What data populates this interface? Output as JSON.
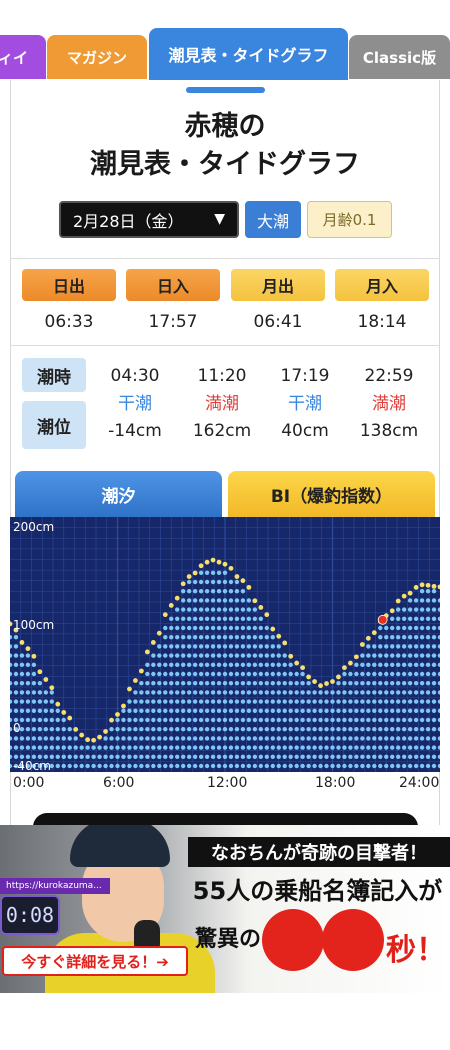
{
  "tabs": [
    {
      "label": "ィイ",
      "active": false
    },
    {
      "label": "マガジン",
      "active": false
    },
    {
      "label": "潮見表・タイドグラフ",
      "active": true
    },
    {
      "label": "Classic版",
      "active": false
    }
  ],
  "page": {
    "title_line1": "赤穂の",
    "title_line2": "潮見表・タイドグラフ",
    "date": "2月28日（金）",
    "tide_type": "大潮",
    "moon_age": "月齢0.1"
  },
  "sun_moon": [
    {
      "label": "日出",
      "time": "06:33",
      "kind": "sun"
    },
    {
      "label": "日入",
      "time": "17:57",
      "kind": "sun"
    },
    {
      "label": "月出",
      "time": "06:41",
      "kind": "moon"
    },
    {
      "label": "月入",
      "time": "18:14",
      "kind": "moon"
    }
  ],
  "tides": {
    "time_label": "潮時",
    "level_label": "潮位",
    "entries": [
      {
        "time": "04:30",
        "kind": "干潮",
        "type": "low",
        "level": "-14cm"
      },
      {
        "time": "11:20",
        "kind": "満潮",
        "type": "high",
        "level": "162cm"
      },
      {
        "time": "17:19",
        "kind": "干潮",
        "type": "low",
        "level": "40cm"
      },
      {
        "time": "22:59",
        "kind": "満潮",
        "type": "high",
        "level": "138cm"
      }
    ]
  },
  "chart_tabs": {
    "active": "潮汐",
    "inactive": "BI（爆釣指数）"
  },
  "chart_data": {
    "type": "area",
    "title": "",
    "xlabel": "",
    "ylabel": "",
    "y_tick_labels": [
      "200cm",
      "100cm",
      "0",
      "-40cm"
    ],
    "x_tick_labels": [
      "0:00",
      "6:00",
      "12:00",
      "18:00",
      "24:00"
    ],
    "ylim": [
      -40,
      200
    ],
    "xlim": [
      0,
      24
    ],
    "grid": true,
    "series": [
      {
        "x": [
          0,
          1,
          2,
          3,
          4,
          4.5,
          5,
          6,
          7,
          8,
          9,
          10,
          11,
          11.33,
          12,
          13,
          14,
          15,
          16,
          17,
          17.32,
          18,
          19,
          20,
          21,
          22,
          22.98,
          24
        ],
        "values": [
          100,
          76,
          46,
          14,
          -8,
          -14,
          -10,
          12,
          45,
          82,
          118,
          146,
          160,
          162,
          158,
          142,
          116,
          88,
          62,
          44,
          40,
          44,
          62,
          86,
          108,
          127,
          138,
          136
        ]
      }
    ],
    "current_time_marker": {
      "x": 20.8,
      "y": 104
    }
  },
  "ad": {
    "url": "https://kurokazuma...",
    "timer": "0:08",
    "cta": "今すぐ詳細を見る！➔",
    "headline": "なおちんが奇跡の目撃者！",
    "headline_highlight": "なおちん",
    "line2": "55人の乗船名簿記入が",
    "line3": "驚異の",
    "line3_end": "秒！"
  },
  "colors": {
    "accent_blue": "#3a86de",
    "sun_orange": "#ef9a34",
    "moon_yellow": "#f4c23e",
    "chart_bg": "#17286a",
    "dot_blue": "#7fc6f2",
    "dot_yellow": "#f7e06a",
    "marker_red": "#e3321d"
  }
}
